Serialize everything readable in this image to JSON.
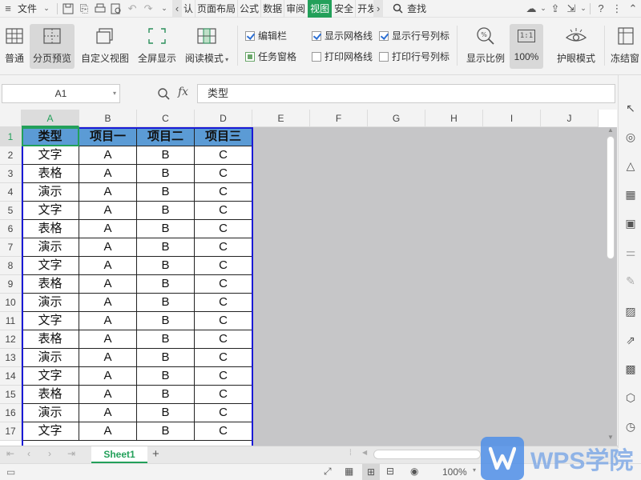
{
  "menubar": {
    "file_label": "文件",
    "tabs": [
      "认",
      "页面布局",
      "公式",
      "数据",
      "审阅",
      "视图",
      "安全",
      "开发"
    ],
    "active_tab": "视图",
    "search_label": "查找"
  },
  "ribbon": {
    "normal": "普通",
    "page_break": "分页预览",
    "custom_view": "自定义视图",
    "full_screen": "全屏显示",
    "reading_mode": "阅读模式",
    "edit_bar": "编辑栏",
    "task_pane": "任务窗格",
    "show_gridlines": "显示网格线",
    "print_gridlines": "打印网格线",
    "show_headers": "显示行号列标",
    "print_headers": "打印行号列标",
    "zoom_ratio": "显示比例",
    "zoom_100": "100%",
    "zoom_100_icon": "1:1",
    "eye_care": "护眼模式",
    "freeze": "冻结窗"
  },
  "formula_bar": {
    "name_box": "A1",
    "fx": "fx",
    "value": "类型"
  },
  "grid": {
    "columns": [
      "A",
      "B",
      "C",
      "D",
      "E",
      "F",
      "G",
      "H",
      "I",
      "J"
    ],
    "rows": [
      "1",
      "2",
      "3",
      "4",
      "5",
      "6",
      "7",
      "8",
      "9",
      "10",
      "11",
      "12",
      "13",
      "14",
      "15",
      "16",
      "17"
    ],
    "header": [
      "类型",
      "项目一",
      "项目二",
      "项目三"
    ],
    "data": [
      [
        "文字",
        "A",
        "B",
        "C"
      ],
      [
        "表格",
        "A",
        "B",
        "C"
      ],
      [
        "演示",
        "A",
        "B",
        "C"
      ],
      [
        "文字",
        "A",
        "B",
        "C"
      ],
      [
        "表格",
        "A",
        "B",
        "C"
      ],
      [
        "演示",
        "A",
        "B",
        "C"
      ],
      [
        "文字",
        "A",
        "B",
        "C"
      ],
      [
        "表格",
        "A",
        "B",
        "C"
      ],
      [
        "演示",
        "A",
        "B",
        "C"
      ],
      [
        "文字",
        "A",
        "B",
        "C"
      ],
      [
        "表格",
        "A",
        "B",
        "C"
      ],
      [
        "演示",
        "A",
        "B",
        "C"
      ],
      [
        "文字",
        "A",
        "B",
        "C"
      ],
      [
        "表格",
        "A",
        "B",
        "C"
      ],
      [
        "演示",
        "A",
        "B",
        "C"
      ],
      [
        "文字",
        "A",
        "B",
        "C"
      ]
    ]
  },
  "sheet_tabs": {
    "active": "Sheet1",
    "add": "+"
  },
  "status": {
    "zoom": "100%"
  },
  "logo": {
    "text": "WPS学院"
  },
  "colors": {
    "accent": "#23a05a",
    "header_fill": "#5b9bd5",
    "page_border": "#1a1ad6",
    "gray_area": "#c6c6c8"
  }
}
